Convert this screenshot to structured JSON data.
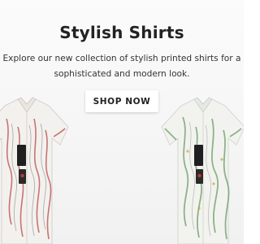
{
  "hero": {
    "title": "Stylish Shirts",
    "description_line1": "Explore our new collection of stylish printed shirts for a",
    "description_line2": "sophisticated and modern look.",
    "cta_label": "SHOP NOW"
  },
  "products": [
    {
      "name": "printed-shirt-white-red",
      "pattern_color": "#b94a4a"
    },
    {
      "name": "printed-shirt-white-green",
      "pattern_color": "#6f9a6a"
    }
  ],
  "colors": {
    "heading": "#222222",
    "body_text": "#333333",
    "button_bg": "#ffffff",
    "background": "#f4f4f4"
  }
}
